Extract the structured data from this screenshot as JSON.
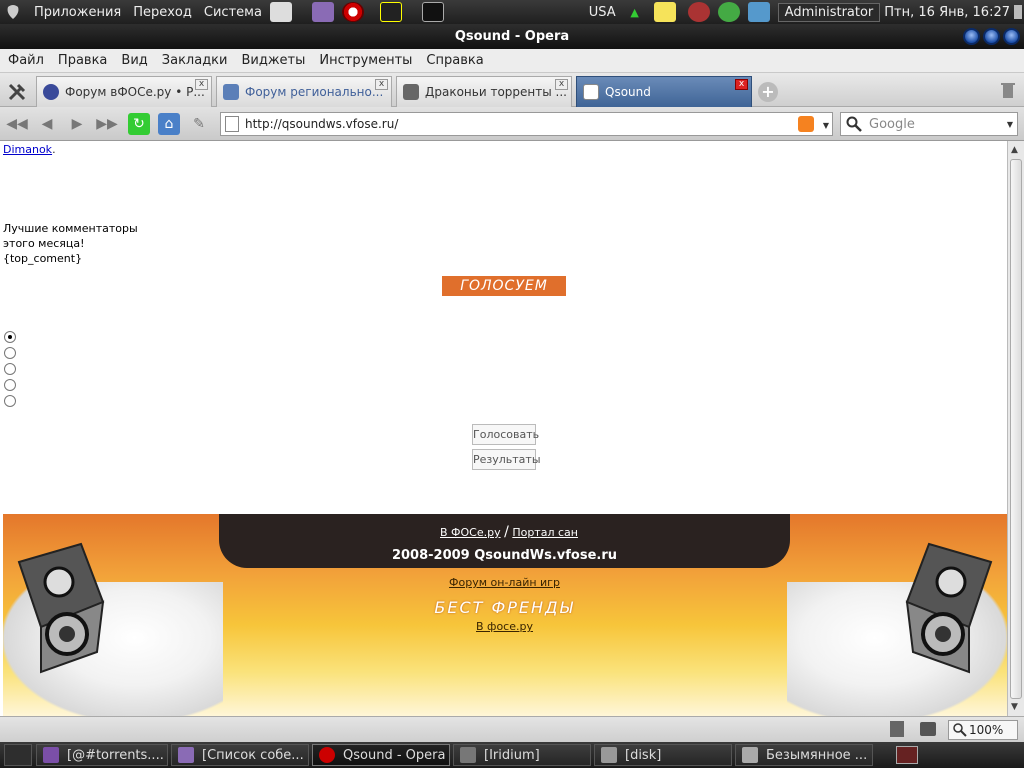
{
  "top_panel": {
    "menus": [
      "Приложения",
      "Переход",
      "Система"
    ],
    "keyboard_layout": "USA",
    "user": "Administrator",
    "clock": "Птн, 16 Янв, 16:27"
  },
  "window": {
    "title": "Qsound - Opera"
  },
  "menubar": {
    "items": [
      "Файл",
      "Правка",
      "Вид",
      "Закладки",
      "Виджеты",
      "Инструменты",
      "Справка"
    ]
  },
  "tabs": [
    {
      "label": "Форум вФОСе.ру • Р...",
      "favicon": "forum-favicon",
      "active": false
    },
    {
      "label": "Форум регионально...",
      "favicon": "p-favicon",
      "active": false
    },
    {
      "label": "Драконьи торренты ...",
      "favicon": "dragon-favicon",
      "active": false
    },
    {
      "label": "Qsound",
      "favicon": "page-favicon",
      "active": true
    }
  ],
  "navigation": {
    "url": "http://qsoundws.vfose.ru/",
    "search_placeholder": "Google"
  },
  "page": {
    "top_link": "Dimanok",
    "top_link_suffix": ".",
    "commentators_line1": "Лучшие комментаторы",
    "commentators_line2": "этого месяца!",
    "commentators_line3": "{top_coment}",
    "vote_banner": "ГОЛОСУЕМ",
    "poll_options_count": 5,
    "poll_selected_index": 0,
    "vote_button": "Голосовать",
    "results_button": "Результаты"
  },
  "footer": {
    "link_vfose": "В ФОСе.ру",
    "separator": "/",
    "link_portal": "Портал сан",
    "copyright": "2008-2009 QsoundWs.vfose.ru",
    "link_forum": "Форум он-лайн игр",
    "best_friends": "БЕСТ ФРЕНДЫ",
    "link_fose": "В фосе.ру"
  },
  "statusbar": {
    "zoom": "100%"
  },
  "taskbar": [
    {
      "label": "[@#torrents....",
      "icon": "viber-icon",
      "active": false
    },
    {
      "label": "[Список собе...",
      "icon": "pidgin-icon",
      "active": false
    },
    {
      "label": "Qsound - Opera",
      "icon": "opera-icon",
      "active": true
    },
    {
      "label": "[Iridium]",
      "icon": "iridium-icon",
      "active": false
    },
    {
      "label": "[disk]",
      "icon": "folder-icon",
      "active": false
    },
    {
      "label": "Безымянное ...",
      "icon": "camera-icon",
      "active": false
    }
  ],
  "colors": {
    "vote_banner": "#e06f2c",
    "active_tab": "#4a6fa5",
    "footer_orange": "#e4772b",
    "footer_yellow": "#f7c53a"
  }
}
